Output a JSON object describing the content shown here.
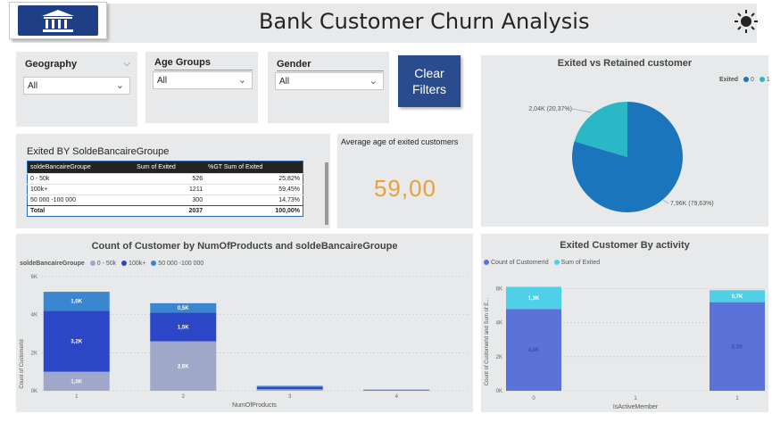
{
  "header": {
    "title": "Bank Customer Churn Analysis"
  },
  "filters": {
    "geography": {
      "label": "Geography",
      "value": "All"
    },
    "age_groups": {
      "label": "Age Groups",
      "value": "All"
    },
    "gender": {
      "label": "Gender",
      "value": "All"
    },
    "clear_label_line1": "Clear",
    "clear_label_line2": "Filters"
  },
  "table_visual": {
    "title": "Exited BY SoldeBancaireGroupe",
    "columns": [
      "soldeBancaireGroupe",
      "Sum of Exited",
      "%GT Sum of Exited"
    ],
    "rows": [
      [
        "0 - 50k",
        "526",
        "25,82%"
      ],
      [
        "100k+",
        "1211",
        "59,45%"
      ],
      [
        "50 000 -100 000",
        "300",
        "14,73%"
      ]
    ],
    "total": [
      "Total",
      "2037",
      "100,00%"
    ]
  },
  "kpi": {
    "title": "Average age of exited customers",
    "value": "59,00"
  },
  "pie": {
    "title": "Exited vs Retained customer",
    "legend_title": "Exited",
    "legend_items": [
      "0",
      "1"
    ],
    "label_exited": "2,04K (20,37%)",
    "label_retained": "7,96K (79,63%)",
    "colors": [
      "#1b75bc",
      "#2ab7c6"
    ]
  },
  "stacked": {
    "title": "Count of Customer by NumOfProducts and soldeBancaireGroupe",
    "legend_title": "soldeBancaireGroupe",
    "legend_items": [
      "0 - 50k",
      "100k+",
      "50 000 -100 000"
    ],
    "ylabel": "Count of CustomerId",
    "xlabel": "NumOfProducts",
    "y_ticks": [
      "0K",
      "2K",
      "4K",
      "6K"
    ],
    "seg_labels": {
      "p1_low": "1,0K",
      "p1_mid": "3,2K",
      "p1_top": "1,0K",
      "p2_low": "2,6K",
      "p2_mid": "1,5K",
      "p2_top": "0,5K"
    }
  },
  "activity": {
    "title": "Exited Customer By activity",
    "legend_items": [
      "Count of CustomerId",
      "Sum of Exited"
    ],
    "ylabel": "Count of CustomerId and Sum of E...",
    "xlabel": "IsActiveMember",
    "y_ticks": [
      "0K",
      "2K",
      "4K",
      "6K"
    ],
    "x_ticks": [
      "0",
      "1",
      "1"
    ],
    "bar_labels": {
      "b0_top": "1,3K",
      "b0_base": "4,8K",
      "b1_top": "0,7K",
      "b1_base": "5,2K"
    }
  },
  "chart_data": [
    {
      "type": "table",
      "title": "Exited BY SoldeBancaireGroupe",
      "categories": [
        "0 - 50k",
        "100k+",
        "50 000 -100 000"
      ],
      "series": [
        {
          "name": "Sum of Exited",
          "values": [
            526,
            1211,
            300
          ]
        },
        {
          "name": "%GT Sum of Exited",
          "values": [
            25.82,
            59.45,
            14.73
          ]
        }
      ]
    },
    {
      "type": "pie",
      "title": "Exited vs Retained customer",
      "categories": [
        "0",
        "1"
      ],
      "values": [
        7960,
        2040
      ]
    },
    {
      "type": "bar",
      "stacked": true,
      "title": "Count of Customer by NumOfProducts and soldeBancaireGroupe",
      "categories": [
        "1",
        "2",
        "3",
        "4"
      ],
      "series": [
        {
          "name": "0 - 50k",
          "values": [
            1000,
            2600,
            80,
            20
          ]
        },
        {
          "name": "100k+",
          "values": [
            3200,
            1500,
            120,
            25
          ]
        },
        {
          "name": "50 000 -100 000",
          "values": [
            1000,
            500,
            60,
            15
          ]
        }
      ],
      "xlabel": "NumOfProducts",
      "ylabel": "Count of CustomerId",
      "ylim": [
        0,
        6000
      ],
      "colors": [
        "#9fa8c8",
        "#2b47c8",
        "#3a87d0"
      ]
    },
    {
      "type": "bar",
      "stacked": true,
      "title": "Exited Customer By activity",
      "categories": [
        "0",
        "1"
      ],
      "series": [
        {
          "name": "Count of CustomerId",
          "values": [
            4800,
            5200
          ]
        },
        {
          "name": "Sum of Exited",
          "values": [
            1300,
            700
          ]
        }
      ],
      "xlabel": "IsActiveMember",
      "ylabel": "Count of CustomerId and Sum of E...",
      "ylim": [
        0,
        6000
      ],
      "colors": [
        "#5b72d8",
        "#4fd0e8"
      ]
    }
  ]
}
